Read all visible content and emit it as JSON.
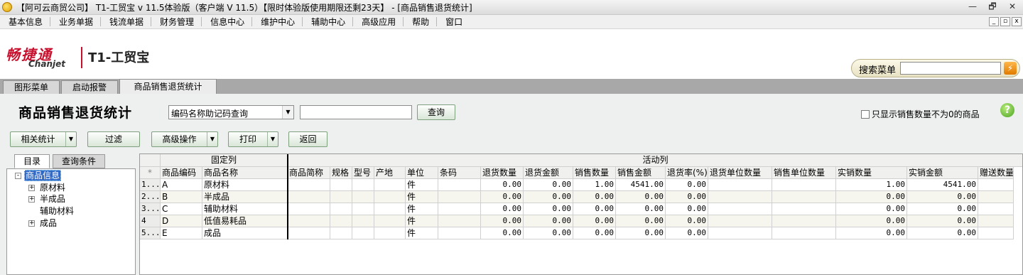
{
  "window": {
    "title": "【阿可云商贸公司】 T1-工贸宝 v 11.5体验版（客户端 V 11.5）【限时体验版使用期限还剩23天】 - [商品销售退货统计]",
    "controls": [
      "—",
      "🗗",
      "✕"
    ]
  },
  "menu": [
    "基本信息",
    "业务单据",
    "钱流单据",
    "财务管理",
    "信息中心",
    "维护中心",
    "辅助中心",
    "高级应用",
    "帮助",
    "窗口"
  ],
  "mdi_controls": [
    "_",
    "▫",
    "x"
  ],
  "logo": {
    "cn": "畅捷通",
    "en": "Chanjet",
    "product": "T1-工贸宝"
  },
  "search": {
    "label": "搜索菜单",
    "value": "",
    "go": "⚡"
  },
  "tabs": [
    "图形菜单",
    "启动报警",
    "商品销售退货统计"
  ],
  "page": {
    "title": "商品销售退货统计",
    "query_mode": "编码名称助记码查询",
    "query_value": "",
    "query_button": "查询",
    "only_nonzero_label": "只显示销售数量不为0的商品",
    "help": "?"
  },
  "toolbar": {
    "related": "相关统计",
    "filter": "过滤",
    "advanced": "高级操作",
    "print": "打印",
    "back": "返回",
    "dropdown": "▼"
  },
  "left_tabs": [
    "目录",
    "查询条件"
  ],
  "tree": {
    "root": "商品信息",
    "nodes": [
      {
        "label": "原材料",
        "expander": "+"
      },
      {
        "label": "半成品",
        "expander": "+"
      },
      {
        "label": "辅助材料",
        "expander": ""
      },
      {
        "label": "成品",
        "expander": "+"
      }
    ],
    "root_expander": "-"
  },
  "grid": {
    "group_fixed": "固定列",
    "group_active": "活动列",
    "corner": "*",
    "columns": [
      "商品编码",
      "商品名称",
      "商品简称",
      "规格",
      "型号",
      "产地",
      "单位",
      "条码",
      "退货数量",
      "退货金额",
      "销售数量",
      "销售金额",
      "退货率(%)",
      "退货单位数量",
      "销售单位数量",
      "实销数量",
      "实销金额",
      "赠送数量"
    ],
    "rows": [
      {
        "num": "1...",
        "cells": [
          "A",
          "原材料",
          "",
          "",
          "",
          "",
          "件",
          "",
          "0.00",
          "0.00",
          "1.00",
          "4541.00",
          "0.00",
          "",
          "",
          "1.00",
          "4541.00",
          ""
        ]
      },
      {
        "num": "2...",
        "cells": [
          "B",
          "半成品",
          "",
          "",
          "",
          "",
          "件",
          "",
          "0.00",
          "0.00",
          "0.00",
          "0.00",
          "0.00",
          "",
          "",
          "0.00",
          "0.00",
          ""
        ]
      },
      {
        "num": "3...",
        "cells": [
          "C",
          "辅助材料",
          "",
          "",
          "",
          "",
          "件",
          "",
          "0.00",
          "0.00",
          "0.00",
          "0.00",
          "0.00",
          "",
          "",
          "0.00",
          "0.00",
          ""
        ]
      },
      {
        "num": "4",
        "cells": [
          "D",
          "低值易耗品",
          "",
          "",
          "",
          "",
          "件",
          "",
          "0.00",
          "0.00",
          "0.00",
          "0.00",
          "0.00",
          "",
          "",
          "0.00",
          "0.00",
          ""
        ]
      },
      {
        "num": "5...",
        "cells": [
          "E",
          "成品",
          "",
          "",
          "",
          "",
          "件",
          "",
          "0.00",
          "0.00",
          "0.00",
          "0.00",
          "0.00",
          "",
          "",
          "0.00",
          "0.00",
          ""
        ]
      }
    ]
  }
}
